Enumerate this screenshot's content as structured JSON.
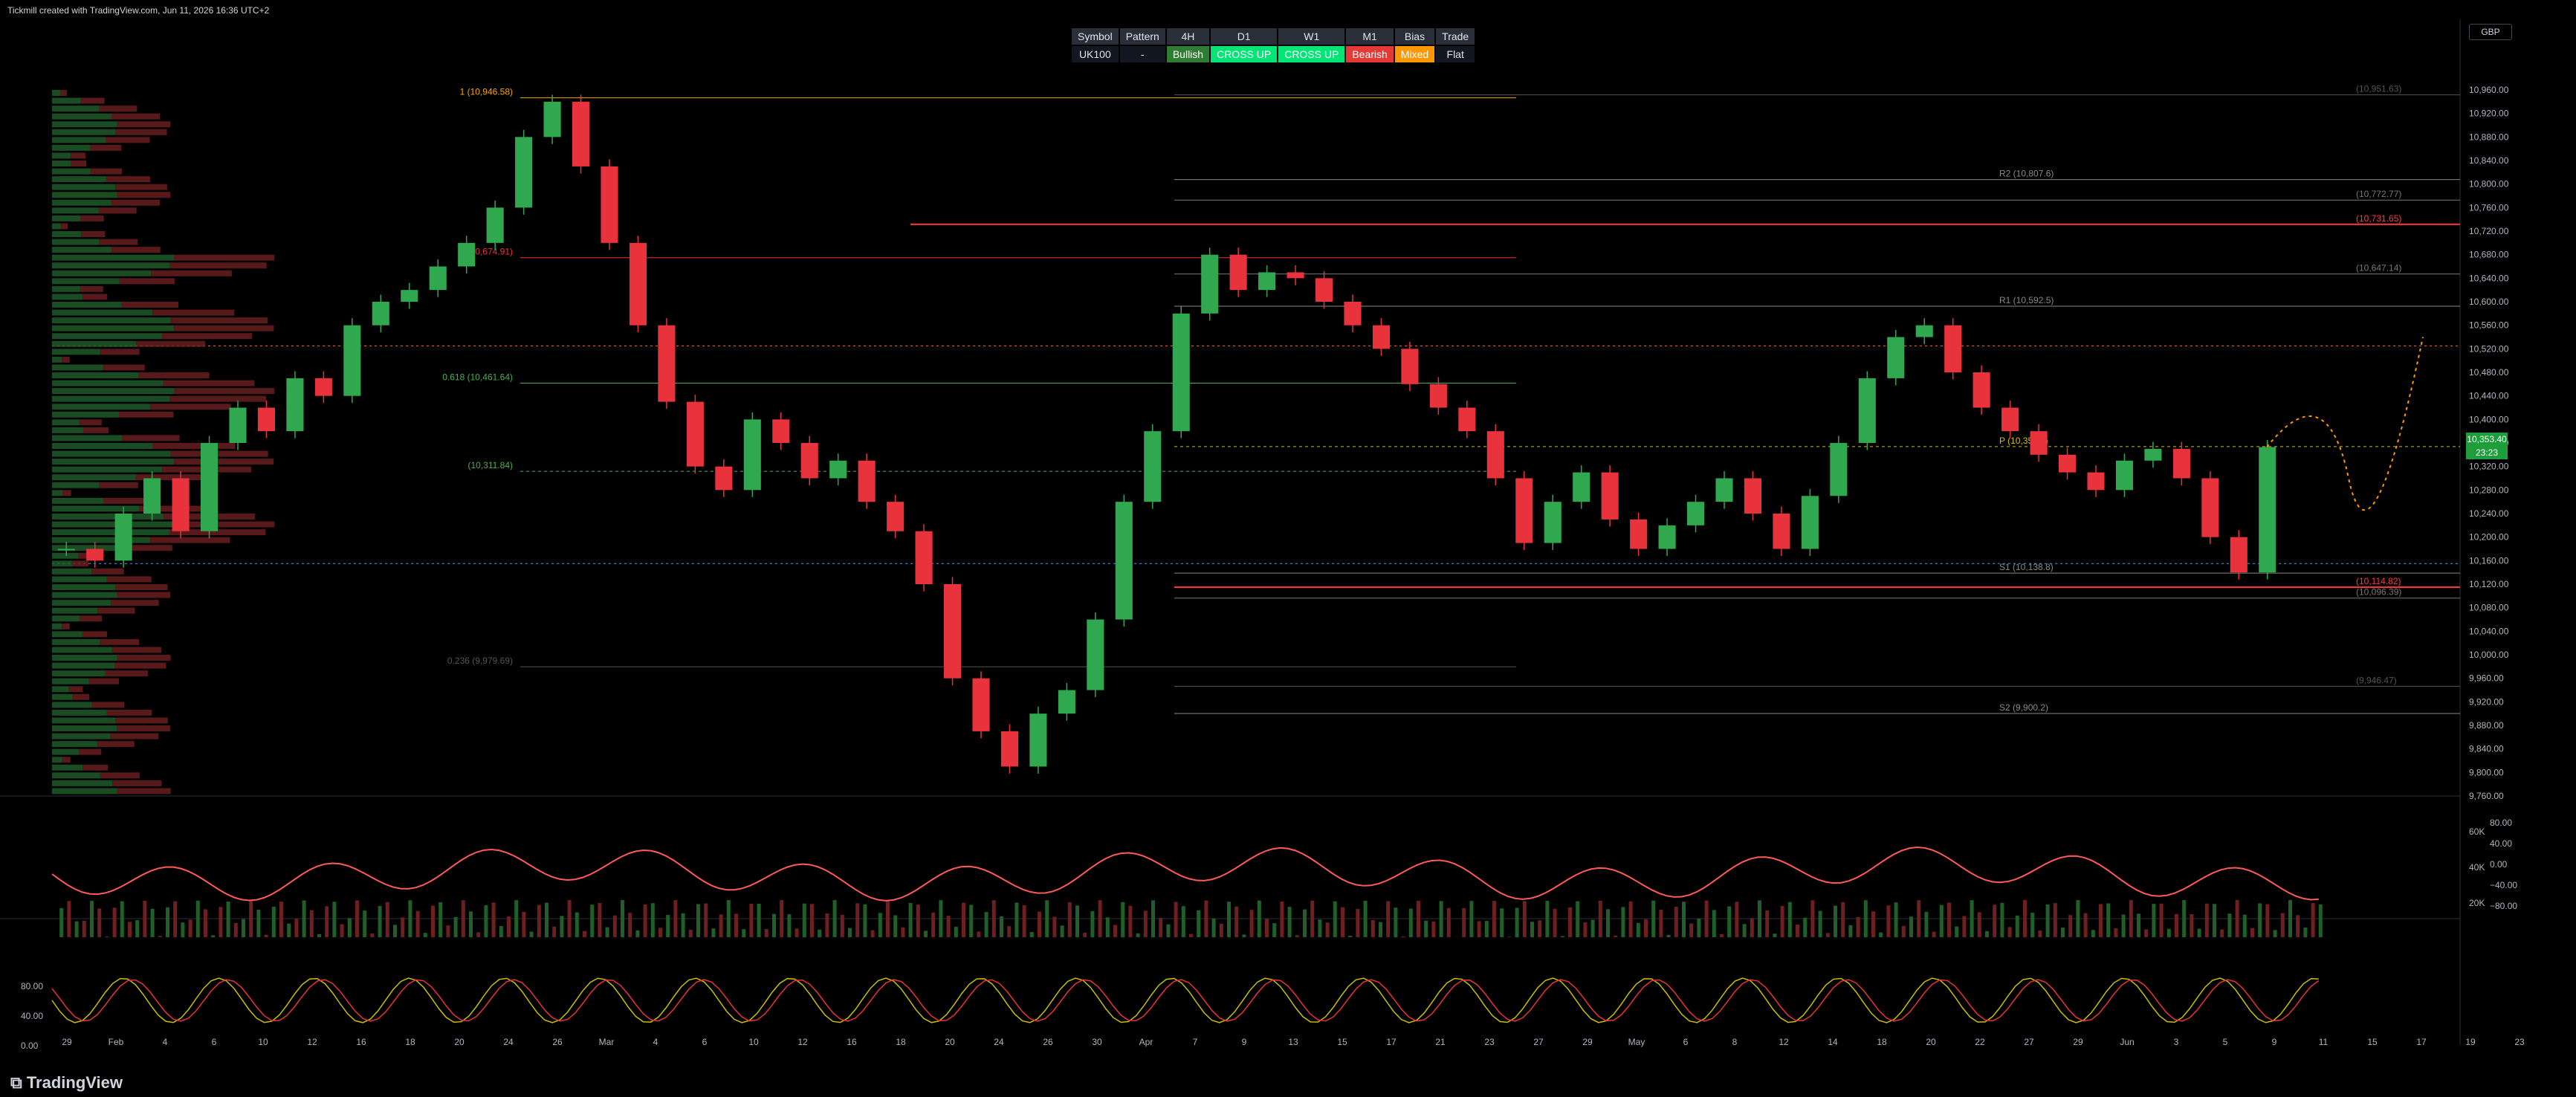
{
  "header": {
    "caption": "Tickmill created with TradingView.com, Jun 11, 2026 16:36 UTC+2",
    "currency": "GBP"
  },
  "status_table": {
    "headers": [
      "Symbol",
      "Pattern",
      "4H",
      "D1",
      "W1",
      "M1",
      "Bias",
      "Trade"
    ],
    "values": [
      "UK100",
      "-",
      "Bullish",
      "CROSS UP",
      "CROSS UP",
      "Bearish",
      "Mixed",
      "Flat"
    ],
    "colors": {
      "Bullish": "#2e7d32",
      "CROSS UP": "#00e676",
      "Bearish": "#e53935",
      "Mixed": "#ff9800"
    }
  },
  "price_badge": {
    "price": "10,353.40",
    "change": "23:23",
    "color": "#1e9e3a"
  },
  "footer": {
    "logo": "TradingView"
  },
  "colors": {
    "up": "#2fa84f",
    "down": "#e8323c",
    "bg": "#000000",
    "grid": "#1a1a1a",
    "axis_text": "#b2b5be"
  },
  "chart_data": {
    "type": "candlestick",
    "symbol": "UK100",
    "ylim": [
      9760,
      10960
    ],
    "y_ticks": [
      "10,960.00",
      "10,920.00",
      "10,880.00",
      "10,840.00",
      "10,800.00",
      "10,760.00",
      "10,720.00",
      "10,680.00",
      "10,640.00",
      "10,600.00",
      "10,560.00",
      "10,520.00",
      "10,480.00",
      "10,440.00",
      "10,400.00",
      "10,360.00",
      "10,320.00",
      "10,280.00",
      "10,240.00",
      "10,200.00",
      "10,160.00",
      "10,120.00",
      "10,080.00",
      "10,040.00",
      "10,000.00",
      "9,960.00",
      "9,920.00",
      "9,880.00",
      "9,840.00",
      "9,800.00",
      "9,760.00"
    ],
    "x_ticks": [
      "29",
      "Feb",
      "4",
      "6",
      "10",
      "12",
      "16",
      "18",
      "20",
      "24",
      "26",
      "Mar",
      "4",
      "6",
      "10",
      "12",
      "16",
      "18",
      "20",
      "24",
      "26",
      "30",
      "Apr",
      "7",
      "9",
      "13",
      "15",
      "17",
      "21",
      "23",
      "27",
      "29",
      "May",
      "6",
      "8",
      "12",
      "14",
      "18",
      "20",
      "22",
      "27",
      "29",
      "Jun",
      "3",
      "5",
      "9",
      "11",
      "15",
      "17",
      "19",
      "23"
    ],
    "close_series": [
      10180,
      10160,
      10240,
      10300,
      10210,
      10360,
      10420,
      10380,
      10470,
      10440,
      10560,
      10600,
      10620,
      10660,
      10700,
      10760,
      10880,
      10940,
      10830,
      10700,
      10560,
      10430,
      10320,
      10280,
      10400,
      10360,
      10300,
      10330,
      10260,
      10210,
      10120,
      9960,
      9870,
      9810,
      9900,
      9940,
      10060,
      10260,
      10380,
      10580,
      10680,
      10620,
      10650,
      10640,
      10600,
      10560,
      10520,
      10460,
      10420,
      10380,
      10300,
      10190,
      10260,
      10310,
      10230,
      10180,
      10220,
      10260,
      10300,
      10240,
      10180,
      10270,
      10360,
      10470,
      10540,
      10560,
      10480,
      10420,
      10380,
      10340,
      10310,
      10280,
      10330,
      10350,
      10300,
      10200,
      10140,
      10353
    ],
    "levels": [
      {
        "label": "1 (10,946.58)",
        "value": 10946.58,
        "color": "#f7a600"
      },
      {
        "label": "(10,674.91)",
        "value": 10674.91,
        "color": "#e8323c"
      },
      {
        "label": "0.618 (10,461.64)",
        "value": 10461.64,
        "color": "#4caf50"
      },
      {
        "label": "(10,311.84)",
        "value": 10311.84,
        "color": "#4caf50"
      },
      {
        "label": "0.236 (9,979.69)",
        "value": 9979.69,
        "color": "#555555"
      },
      {
        "label": "(10,951.63)",
        "value": 10951.63,
        "color": "#555555"
      },
      {
        "label": "R2 (10,807.6)",
        "value": 10807.6,
        "color": "#888888"
      },
      {
        "label": "(10,772.77)",
        "value": 10772.77,
        "color": "#777777"
      },
      {
        "label": "(10,731.65)",
        "value": 10731.65,
        "color": "#ff3b3b"
      },
      {
        "label": "(10,647.14)",
        "value": 10647.14,
        "color": "#777777"
      },
      {
        "label": "R1 (10,592.5)",
        "value": 10592.5,
        "color": "#888888"
      },
      {
        "label": "P (10,353.9)",
        "value": 10353.9,
        "color": "#d4c000"
      },
      {
        "label": "S1 (10,138.8)",
        "value": 10138.8,
        "color": "#888888"
      },
      {
        "label": "(10,114.82)",
        "value": 10114.82,
        "color": "#ff3b3b"
      },
      {
        "label": "(10,096.39)",
        "value": 10096.39,
        "color": "#777777"
      },
      {
        "label": "(9,946.47)",
        "value": 9946.47,
        "color": "#555555"
      },
      {
        "label": "S2 (9,900.2)",
        "value": 9900.2,
        "color": "#888888"
      }
    ],
    "rsi": {
      "y_ticks": [
        "80.00",
        "40.00",
        "0.00",
        "−40.00",
        "−80.00"
      ],
      "vol_ticks": [
        "60K",
        "40K",
        "20K"
      ]
    },
    "stoch": {
      "y_ticks": [
        "80.00",
        "40.00",
        "0.00"
      ]
    }
  }
}
